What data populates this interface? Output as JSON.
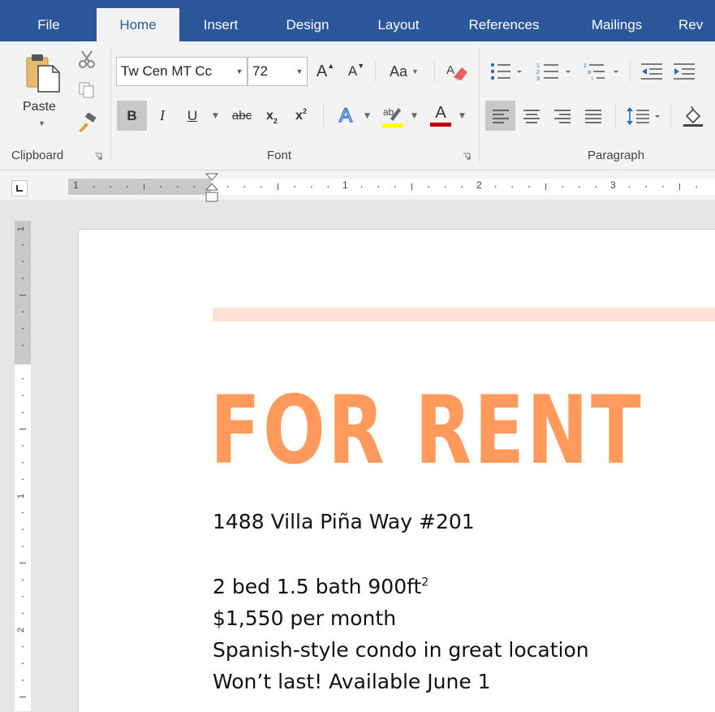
{
  "tabs": [
    "File",
    "Home",
    "Insert",
    "Design",
    "Layout",
    "References",
    "Mailings",
    "Rev"
  ],
  "active_tab": "Home",
  "ribbon": {
    "clipboard": {
      "label": "Clipboard",
      "paste_label": "Paste"
    },
    "font": {
      "label": "Font",
      "font_name": "Tw Cen MT Cc",
      "font_size": "72",
      "change_case": "Aa",
      "bold": "B",
      "italic": "I",
      "underline": "U",
      "strikethrough": "abc",
      "subscript": "x",
      "superscript": "x",
      "grow": "A",
      "shrink": "A",
      "font_color": "A",
      "text_effects": "A"
    },
    "paragraph": {
      "label": "Paragraph"
    }
  },
  "ruler": {
    "h_numbers": [
      "1",
      "1",
      "2",
      "3"
    ],
    "v_numbers": [
      "1",
      "1",
      "2"
    ]
  },
  "document": {
    "headline": "FOR RENT",
    "address": "1488 Villa Piña Way #201",
    "beds": "2 bed 1.5 bath 900ft",
    "beds_sup": "2",
    "price": "$1,550 per month",
    "desc": "Spanish-style condo in great location",
    "avail": "Won’t last! Available June 1"
  },
  "colors": {
    "ribbon_blue": "#2b579a",
    "headline": "#ff9a5c",
    "accent_bar": "#fde1d2",
    "highlight": "#ffff00",
    "font_color_underline": "#c00000"
  }
}
